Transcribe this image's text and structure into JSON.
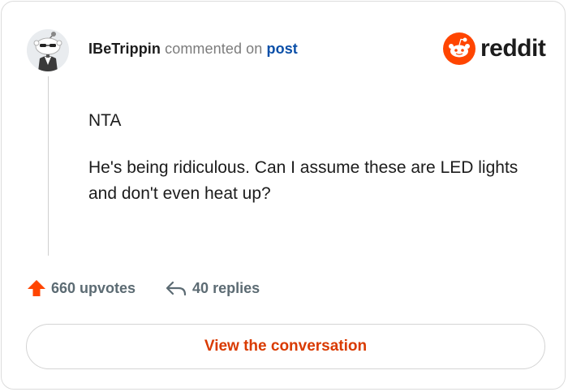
{
  "comment": {
    "username": "IBeTrippin",
    "action_text": "commented on",
    "post_link": "post",
    "body": [
      "NTA",
      "He's being ridiculous. Can I assume these are LED lights and don't even heat up?"
    ]
  },
  "brand": {
    "logo_text": "reddit",
    "logo_color": "#ff4500"
  },
  "stats": {
    "upvotes": "660 upvotes",
    "replies": "40 replies"
  },
  "cta": {
    "label": "View the conversation",
    "color": "#d93a00"
  },
  "icons": {
    "upvote": "upvote-arrow-icon",
    "reply": "reply-arrow-icon",
    "avatar": "snoo-avatar-icon",
    "logo": "reddit-snoo-logo-icon"
  }
}
